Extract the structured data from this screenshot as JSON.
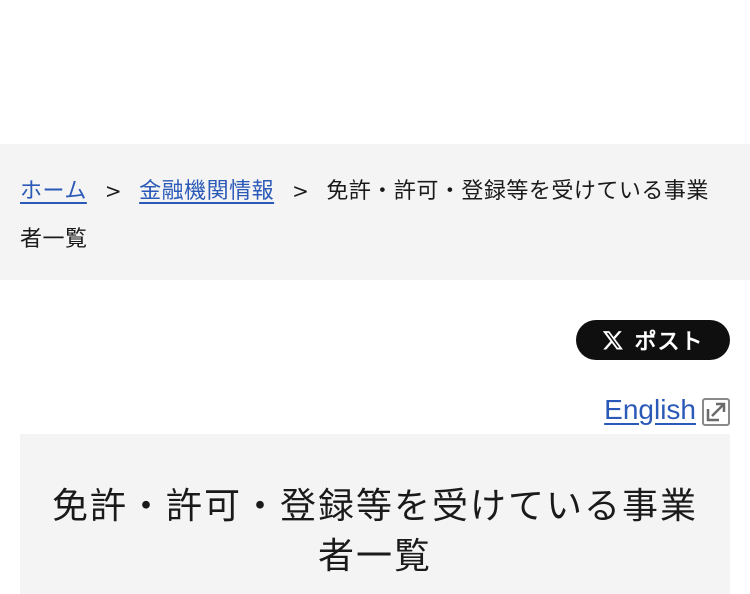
{
  "breadcrumb": {
    "home": "ホーム",
    "separator": ">",
    "finance": "金融機関情報",
    "current": "免許・許可・登録等を受けている事業者一覧"
  },
  "social": {
    "post_label": "ポスト",
    "icon": "x-logo-icon"
  },
  "language": {
    "english_label": "English",
    "icon": "external-link-icon"
  },
  "page": {
    "title": "免許・許可・登録等を受けている事業者一覧"
  },
  "colors": {
    "link": "#2a59b8",
    "breadcrumb_bg": "#f4f4f4",
    "post_button_bg": "#0f0f0f"
  }
}
